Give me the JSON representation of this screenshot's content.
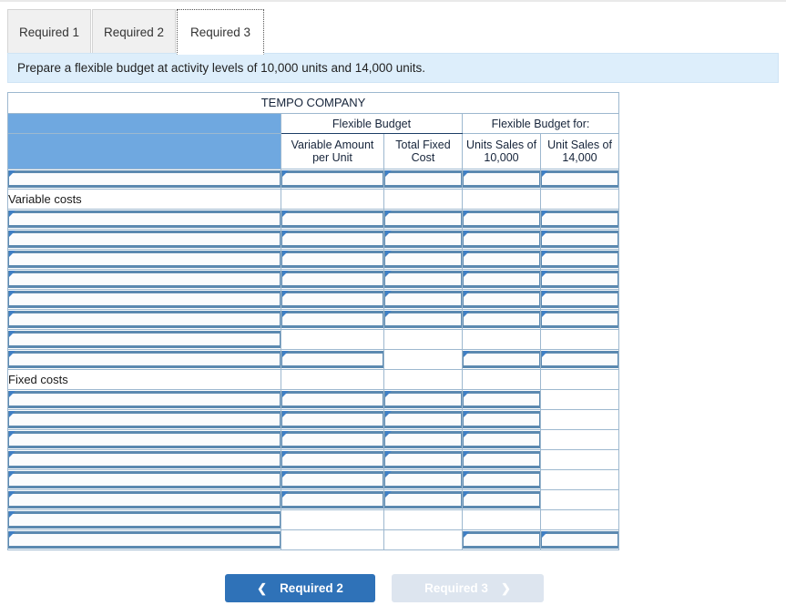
{
  "tabs": [
    {
      "label": "Required 1",
      "active": false
    },
    {
      "label": "Required 2",
      "active": false
    },
    {
      "label": "Required 3",
      "active": true
    }
  ],
  "banner": {
    "text": "Prepare a flexible budget at activity levels of 10,000 units and 14,000 units."
  },
  "sheet": {
    "title": "TEMPO COMPANY",
    "group_headers": {
      "flexible_budget": "Flexible Budget",
      "flexible_budget_for": "Flexible Budget for:"
    },
    "columns": [
      {
        "key": "label",
        "header": ""
      },
      {
        "key": "variable_amount_per_unit",
        "header": "Variable Amount per Unit"
      },
      {
        "key": "total_fixed_cost",
        "header": "Total Fixed Cost"
      },
      {
        "key": "units_sales_of_10000",
        "header": "Units Sales of 10,000"
      },
      {
        "key": "unit_sales_of_14000",
        "header": "Unit Sales of 14,000"
      }
    ],
    "section_labels": {
      "variable_costs": "Variable costs",
      "fixed_costs": "Fixed costs"
    },
    "rows": [
      {
        "kind": "input",
        "label": "",
        "cells": [
          "input",
          "input",
          "input",
          "input"
        ]
      },
      {
        "kind": "section",
        "label": "Variable costs",
        "cells": [
          "empty",
          "empty",
          "empty",
          "empty"
        ]
      },
      {
        "kind": "input",
        "label": "",
        "cells": [
          "input",
          "input",
          "input",
          "input"
        ]
      },
      {
        "kind": "input",
        "label": "",
        "cells": [
          "input",
          "input",
          "input",
          "input"
        ]
      },
      {
        "kind": "input",
        "label": "",
        "cells": [
          "input",
          "input",
          "input",
          "input"
        ]
      },
      {
        "kind": "input",
        "label": "",
        "cells": [
          "input",
          "input",
          "input",
          "input"
        ]
      },
      {
        "kind": "input",
        "label": "",
        "cells": [
          "input",
          "input",
          "input",
          "input"
        ]
      },
      {
        "kind": "input",
        "label": "",
        "cells": [
          "input",
          "input",
          "input",
          "input"
        ]
      },
      {
        "kind": "input-rule",
        "label": "",
        "cells": [
          "empty",
          "empty",
          "empty",
          "empty"
        ]
      },
      {
        "kind": "subtotal",
        "label": "",
        "cells": [
          "input-underline",
          "empty",
          "input",
          "input"
        ]
      },
      {
        "kind": "section",
        "label": "Fixed costs",
        "cells": [
          "empty",
          "empty",
          "empty",
          "empty"
        ]
      },
      {
        "kind": "input",
        "label": "",
        "cells": [
          "input",
          "input",
          "input",
          "empty"
        ]
      },
      {
        "kind": "input",
        "label": "",
        "cells": [
          "input",
          "input",
          "input",
          "empty"
        ]
      },
      {
        "kind": "input",
        "label": "",
        "cells": [
          "input",
          "input",
          "input",
          "empty"
        ]
      },
      {
        "kind": "input",
        "label": "",
        "cells": [
          "input",
          "input",
          "input",
          "empty"
        ]
      },
      {
        "kind": "input",
        "label": "",
        "cells": [
          "input",
          "input",
          "input",
          "empty"
        ]
      },
      {
        "kind": "input",
        "label": "",
        "cells": [
          "input",
          "input",
          "input",
          "empty"
        ]
      },
      {
        "kind": "subtotal2",
        "label": "",
        "cells": [
          "empty",
          "empty-underline",
          "empty",
          "empty"
        ]
      },
      {
        "kind": "total",
        "label": "",
        "cells": [
          "empty",
          "empty",
          "input",
          "input"
        ]
      }
    ]
  },
  "nav": {
    "prev_label": "Required 2",
    "prev_icon": "chevron-left-icon",
    "next_label": "Required 3",
    "next_icon": "chevron-right-icon"
  },
  "colors": {
    "header_blue": "#6fa8e0",
    "banner_blue": "#ddeefb",
    "input_border": "#5b89b0",
    "flag_blue": "#3f7fc4",
    "button_active": "#2f72b8",
    "button_disabled": "#dde5ef"
  }
}
